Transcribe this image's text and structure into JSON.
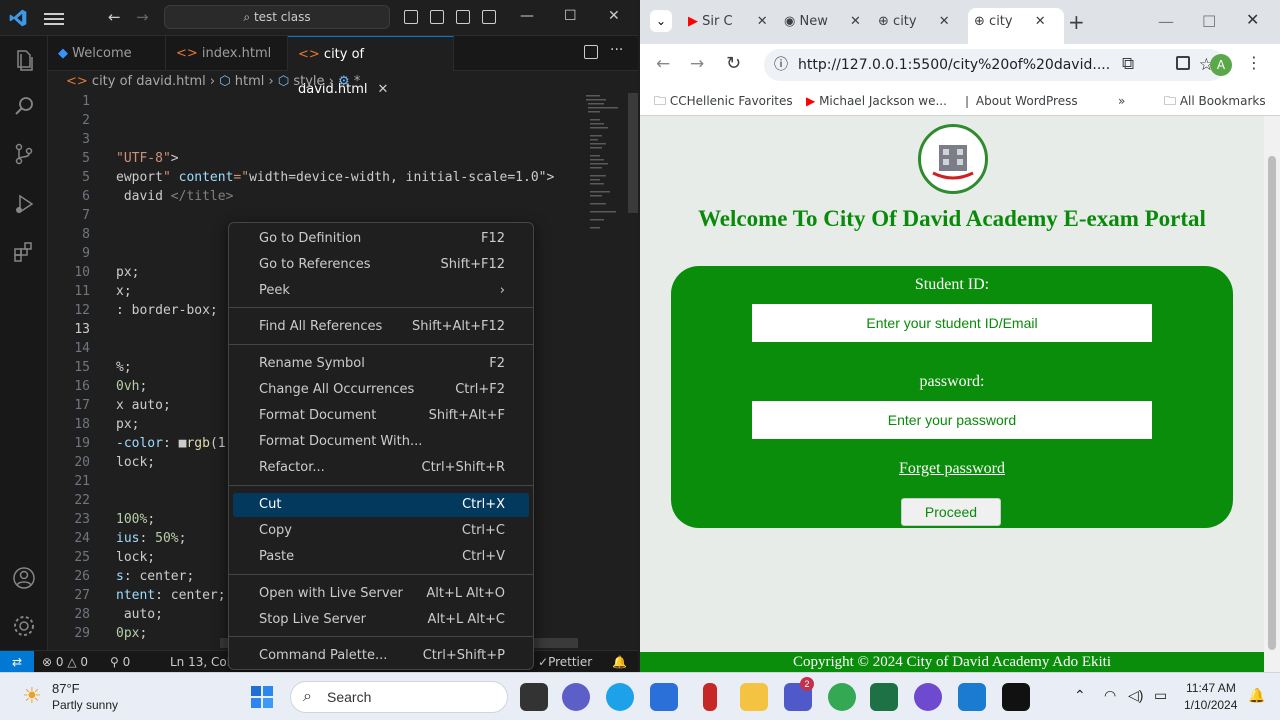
{
  "vscode": {
    "search": "test class",
    "tabs": [
      {
        "label": "Welcome"
      },
      {
        "label": "index.html"
      },
      {
        "label": "city of david.html"
      }
    ],
    "breadcrumb": [
      "city of david.html",
      "html",
      "style",
      "*"
    ],
    "code_lines": [
      {
        "n": "1",
        "t": ""
      },
      {
        "n": "2",
        "t": ""
      },
      {
        "n": "3",
        "t": ""
      },
      {
        "n": "5",
        "t": "\"UTF-8\">"
      },
      {
        "n": "5",
        "t": "ewport\" content=\"width=device-width, initial-scale=1.0\">"
      },
      {
        "n": "6",
        "t": " david </title>"
      },
      {
        "n": "7",
        "t": ""
      },
      {
        "n": "8",
        "t": ""
      },
      {
        "n": "9",
        "t": ""
      },
      {
        "n": "10",
        "t": "px;"
      },
      {
        "n": "11",
        "t": "x;"
      },
      {
        "n": "12",
        "t": ": border-box;"
      },
      {
        "n": "13",
        "t": ""
      },
      {
        "n": "14",
        "t": ""
      },
      {
        "n": "15",
        "t": "%;"
      },
      {
        "n": "16",
        "t": "0vh;"
      },
      {
        "n": "17",
        "t": "x auto;"
      },
      {
        "n": "18",
        "t": "px;"
      },
      {
        "n": "19",
        "t": "-color: ■rgb(1"
      },
      {
        "n": "20",
        "t": "lock;"
      },
      {
        "n": "21",
        "t": ""
      },
      {
        "n": "22",
        "t": ""
      },
      {
        "n": "23",
        "t": "100%;"
      },
      {
        "n": "24",
        "t": "ius: 50%;"
      },
      {
        "n": "25",
        "t": "lock;"
      },
      {
        "n": "26",
        "t": "s: center;"
      },
      {
        "n": "27",
        "t": "ntent: center;"
      },
      {
        "n": "28",
        "t": " auto;"
      },
      {
        "n": "29",
        "t": "0px;"
      }
    ],
    "status": {
      "errors": "0",
      "warnings": "0",
      "ports": "0",
      "position": "Ln 13, Col 6",
      "prettier": "Prettier"
    },
    "context_menu": [
      {
        "label": "Go to Definition",
        "kb": "F12"
      },
      {
        "label": "Go to References",
        "kb": "Shift+F12"
      },
      {
        "label": "Peek",
        "kb": "›"
      },
      {
        "label": "Find All References",
        "kb": "Shift+Alt+F12"
      },
      {
        "label": "Rename Symbol",
        "kb": "F2"
      },
      {
        "label": "Change All Occurrences",
        "kb": "Ctrl+F2"
      },
      {
        "label": "Format Document",
        "kb": "Shift+Alt+F"
      },
      {
        "label": "Format Document With...",
        "kb": ""
      },
      {
        "label": "Refactor...",
        "kb": "Ctrl+Shift+R"
      },
      {
        "label": "Cut",
        "kb": "Ctrl+X"
      },
      {
        "label": "Copy",
        "kb": "Ctrl+C"
      },
      {
        "label": "Paste",
        "kb": "Ctrl+V"
      },
      {
        "label": "Open with Live Server",
        "kb": "Alt+L Alt+O"
      },
      {
        "label": "Stop Live Server",
        "kb": "Alt+L Alt+C"
      },
      {
        "label": "Command Palette...",
        "kb": "Ctrl+Shift+P"
      }
    ]
  },
  "chrome": {
    "tabs": [
      {
        "label": "Sir C"
      },
      {
        "label": "New"
      },
      {
        "label": "city"
      },
      {
        "label": "city"
      }
    ],
    "url": "http://127.0.0.1:5500/city%20of%20david....",
    "profile": "A",
    "bookmarks": [
      "CCHellenic Favorites",
      "Michael Jackson we...",
      "About WordPress",
      "All Bookmarks"
    ]
  },
  "page": {
    "title": "Welcome To City Of David Academy E-exam Portal",
    "student_label": "Student ID:",
    "student_placeholder": "Enter your student ID/Email",
    "password_label": "password:",
    "password_placeholder": "Enter your password",
    "forget": "Forget password",
    "proceed": "Proceed",
    "footer": "Copyright © 2024 City of David Academy Ado Ekiti"
  },
  "taskbar": {
    "weather_temp": "87°F",
    "weather_desc": "Partly sunny",
    "search": "Search",
    "time": "11:47 AM",
    "date": "1/10/2024",
    "teams_badge": "2"
  }
}
